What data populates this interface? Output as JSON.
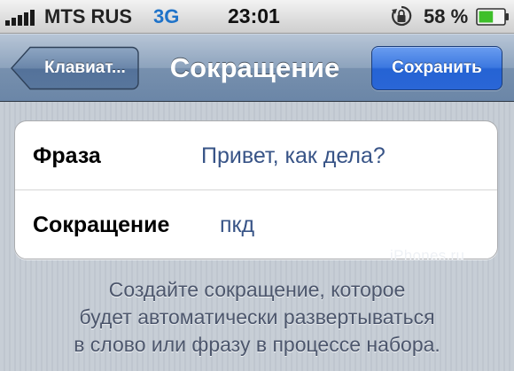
{
  "status_bar": {
    "carrier": "MTS RUS",
    "network": "3G",
    "time": "23:01",
    "battery_percent": "58 %",
    "signal_bars": 5,
    "battery_level": 0.58,
    "network_color": "#1f73c9",
    "battery_color": "#3ebf2a",
    "icons": [
      "signal-icon",
      "orientation-lock-icon",
      "battery-icon"
    ]
  },
  "nav_bar": {
    "back_label": "Клавиат...",
    "title": "Сокращение",
    "save_label": "Сохранить",
    "save_color": "#2563d4"
  },
  "form": {
    "rows": [
      {
        "label": "Фраза",
        "value": "Привет, как дела?"
      },
      {
        "label": "Сокращение",
        "value": "пкд"
      }
    ]
  },
  "footer": {
    "lines": [
      "Создайте сокращение, которое",
      "будет автоматически развертываться",
      "в слово или фразу в процессе набора."
    ]
  },
  "watermark": "iPhones.ru"
}
